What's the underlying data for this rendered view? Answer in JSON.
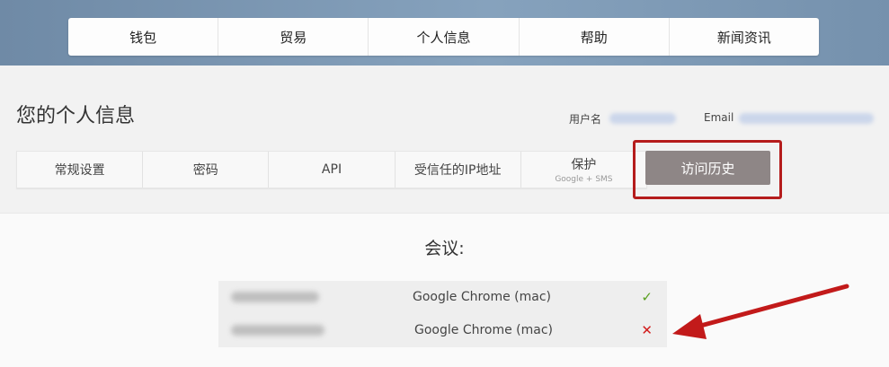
{
  "top_nav": {
    "items": [
      "钱包",
      "贸易",
      "个人信息",
      "帮助",
      "新闻资讯"
    ]
  },
  "page": {
    "title": "您的个人信息",
    "username_label": "用户名",
    "email_label": "Email"
  },
  "tabs": [
    {
      "label": "常规设置",
      "sub": ""
    },
    {
      "label": "密码",
      "sub": ""
    },
    {
      "label": "API",
      "sub": ""
    },
    {
      "label": "受信任的IP地址",
      "sub": ""
    },
    {
      "label": "保护",
      "sub": "Google + SMS"
    }
  ],
  "active_tab": {
    "label": "访问历史"
  },
  "sessions": {
    "title": "会议:",
    "rows": [
      {
        "browser": "Google Chrome (mac)",
        "status": "✓",
        "status_type": "ok"
      },
      {
        "browser": "Google Chrome (mac)",
        "status": "✕",
        "status_type": "failed"
      }
    ]
  },
  "colors": {
    "accent_red": "#b51c1c",
    "active_tab_bg": "#8e8686",
    "ok_green": "#5aa020",
    "fail_red": "#d21c1c"
  }
}
